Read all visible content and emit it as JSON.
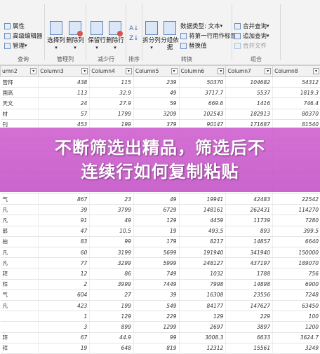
{
  "ribbon": {
    "groups": {
      "query": {
        "label": "查询",
        "items": [
          "属性",
          "高级编辑器",
          "管理"
        ]
      },
      "manage_columns": {
        "label": "管理列",
        "select": "选择列",
        "remove": "删除列"
      },
      "reduce_rows": {
        "label": "减少行",
        "keep": "保留行",
        "remove": "删除行"
      },
      "sort": {
        "label": "排序"
      },
      "transform": {
        "label": "转换",
        "split": "拆分列",
        "group": "分组依据",
        "data_type": "数据类型: 文本",
        "first_row_header": "将第一行用作标题",
        "replace_values": "替换值"
      },
      "combine": {
        "label": "组合",
        "merge": "合并查询",
        "append": "追加查询",
        "merge_files": "合并文件"
      }
    }
  },
  "grid": {
    "headers": [
      "umn2",
      "Column3",
      "Column4",
      "Column5",
      "Column6",
      "Column7",
      "Column8"
    ],
    "rows": [
      [
        "营拜",
        "438",
        "115",
        "239",
        "50370",
        "104682",
        "54312"
      ],
      [
        "国高",
        "113",
        "32.9",
        "49",
        "3717.7",
        "5537",
        "1819.3"
      ],
      [
        "天文",
        "24",
        "27.9",
        "59",
        "669.6",
        "1416",
        "746.4"
      ],
      [
        "材",
        "57",
        "1799",
        "3209",
        "102543",
        "182913",
        "80370"
      ],
      [
        "刊",
        "453",
        "199",
        "379",
        "90147",
        "171687",
        "81540"
      ],
      [
        "",
        "",
        "",
        "",
        "",
        "",
        ""
      ],
      [
        "",
        "",
        "",
        "",
        "",
        "",
        ""
      ],
      [
        "",
        "",
        "",
        "",
        "",
        "",
        ""
      ],
      [
        "",
        "",
        "",
        "",
        "",
        "",
        ""
      ],
      [
        "",
        "",
        "",
        "",
        "",
        "",
        ""
      ],
      [
        "",
        "",
        "",
        "",
        "",
        "",
        ""
      ],
      [
        "气",
        "867",
        "23",
        "49",
        "19941",
        "42483",
        "22542"
      ],
      [
        "凡",
        "39",
        "3799",
        "6729",
        "148161",
        "262431",
        "114270"
      ],
      [
        "凡",
        "91",
        "49",
        "129",
        "4459",
        "11739",
        "7280"
      ],
      [
        "郎",
        "47",
        "10.5",
        "19",
        "493.5",
        "893",
        "399.5"
      ],
      [
        "拍",
        "83",
        "99",
        "179",
        "8217",
        "14857",
        "6640"
      ],
      [
        "凡",
        "60",
        "3199",
        "5699",
        "191940",
        "341940",
        "150000"
      ],
      [
        "凡",
        "77",
        "3299",
        "5999",
        "248127",
        "437197",
        "189070"
      ],
      [
        "拜",
        "12",
        "86",
        "749",
        "1032",
        "1788",
        "756"
      ],
      [
        "拜",
        "2",
        "3999",
        "7449",
        "7998",
        "14898",
        "6900"
      ],
      [
        "气",
        "604",
        "27",
        "39",
        "16308",
        "23556",
        "7248"
      ],
      [
        "凡",
        "423",
        "199",
        "549",
        "84177",
        "147627",
        "63450"
      ],
      [
        "",
        "1",
        "129",
        "229",
        "129",
        "229",
        "100"
      ],
      [
        "",
        "3",
        "899",
        "1299",
        "2697",
        "3897",
        "1200"
      ],
      [
        "拜",
        "67",
        "44.9",
        "99",
        "3008.3",
        "6633",
        "3624.7"
      ],
      [
        "拜",
        "19",
        "648",
        "819",
        "12312",
        "15561",
        "3249"
      ]
    ]
  },
  "banner": {
    "title": "不断筛选出精品，筛选后不\n连续行如何复制粘贴"
  }
}
